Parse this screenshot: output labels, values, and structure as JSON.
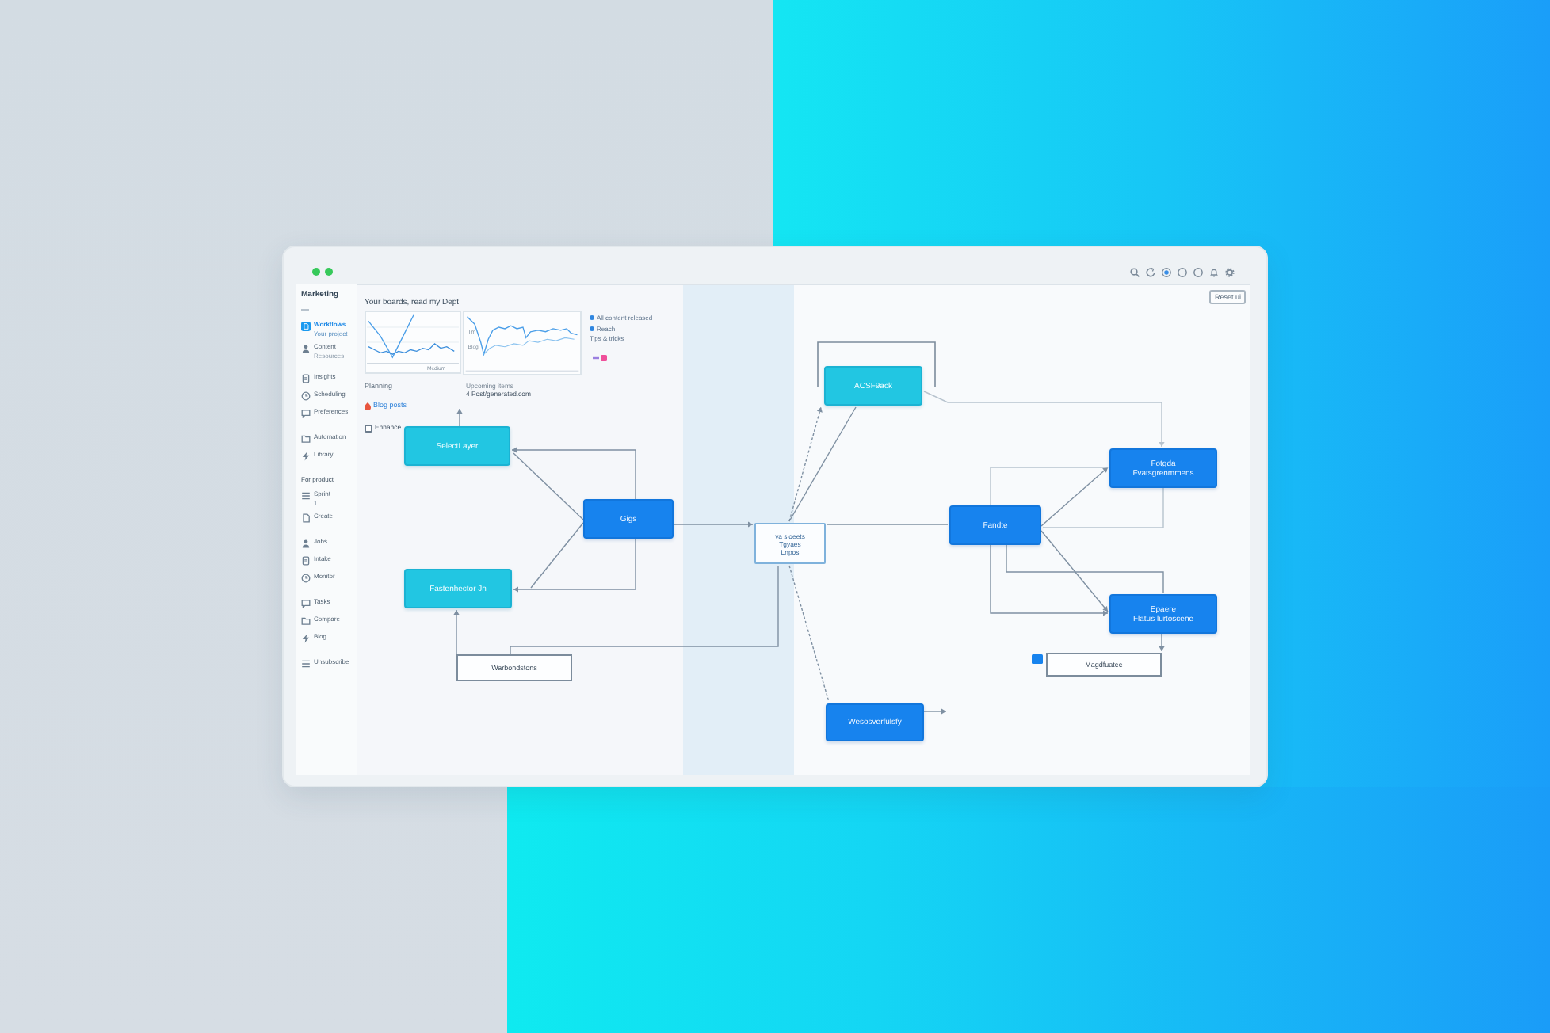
{
  "sidebar": {
    "title": "Marketing",
    "sections": [
      {
        "items": [
          {
            "label": "Workflows",
            "sub": "Your project",
            "selected": true
          },
          {
            "label": "Content",
            "sub": "Resources",
            "selected": false
          }
        ]
      },
      {
        "items": [
          {
            "label": "Insights",
            "selected": false
          },
          {
            "label": "Scheduling",
            "selected": false
          },
          {
            "label": "Preferences",
            "selected": false
          }
        ]
      },
      {
        "items": [
          {
            "label": "Automation",
            "selected": false
          },
          {
            "label": "Library",
            "selected": false
          }
        ]
      },
      {
        "heading": "For product",
        "items": [
          {
            "label": "Sprint",
            "sub": "1",
            "selected": false
          },
          {
            "label": "Create",
            "selected": false
          }
        ]
      },
      {
        "items": [
          {
            "label": "Jobs",
            "selected": false
          },
          {
            "label": "Intake",
            "selected": false
          },
          {
            "label": "Monitor",
            "selected": false
          }
        ]
      },
      {
        "items": [
          {
            "label": "Tasks",
            "selected": false
          },
          {
            "label": "Compare",
            "selected": false
          },
          {
            "label": "Blog",
            "selected": false
          }
        ]
      },
      {
        "items": [
          {
            "label": "Unsubscribe",
            "selected": false
          }
        ]
      }
    ]
  },
  "toolbar": {
    "button": "Reset ui"
  },
  "overview": {
    "title": "Your boards, read my Dept",
    "charts": [
      {
        "labels": [
          "Mcdium"
        ]
      },
      {
        "labels": [
          "Tm",
          "Blog"
        ]
      }
    ],
    "legend": [
      {
        "kind": "series",
        "label": "All content released"
      },
      {
        "kind": "series",
        "label": "Reach"
      },
      {
        "kind": "note",
        "label": "Tips & tricks"
      }
    ],
    "planning": {
      "heading": "Planning",
      "items": [
        {
          "kind": "tag",
          "label": "Blog posts"
        },
        {
          "kind": "checkbox",
          "label": "Enhance",
          "checked": false
        }
      ]
    },
    "upcoming": {
      "heading": "Upcoming items",
      "text": "4 Post/generated.com"
    }
  },
  "diagram": {
    "nodes": [
      {
        "kind": "accent",
        "label": "SelectLayer"
      },
      {
        "kind": "primary",
        "label": "Gigs"
      },
      {
        "kind": "accent",
        "label": "Fastenhector Jn"
      },
      {
        "kind": "note",
        "label": "Warbondstons"
      },
      {
        "kind": "memo",
        "label": "va sloeets\nTgyaes\nLnpos"
      },
      {
        "kind": "accent",
        "label": "ACSF9ack"
      },
      {
        "kind": "primary",
        "label": "Fandte"
      },
      {
        "kind": "primary",
        "label": "Fotgda\nFvatsgrenmmens"
      },
      {
        "kind": "primary",
        "label": "Epaere\nFlatus lurtoscene"
      },
      {
        "kind": "tagged",
        "label": "Magdfuatee"
      },
      {
        "kind": "primary",
        "label": "Wesosverfulsfy"
      }
    ]
  }
}
